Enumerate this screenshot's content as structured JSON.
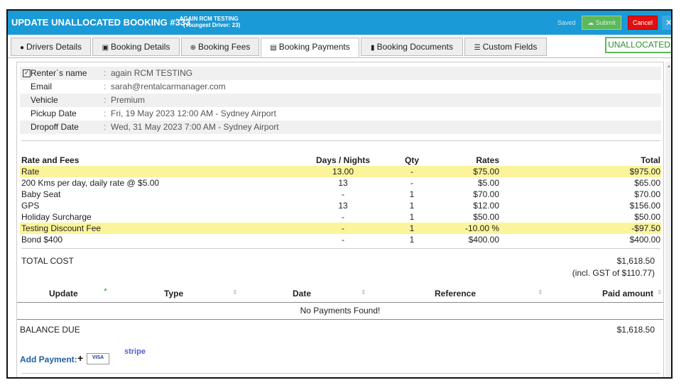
{
  "header": {
    "title": "UPDATE UNALLOCATED BOOKING #333",
    "subtitle_line1": "- AGAIN RCM TESTING",
    "subtitle_line2": "(Youngest Driver: 23)",
    "saved": "Saved",
    "submit_label": "Submit",
    "cancel_label": "Cancel",
    "close_label": "✕",
    "accent_color": "#1a9ad6"
  },
  "tabs": [
    {
      "label": "Drivers Details",
      "icon": "user-icon"
    },
    {
      "label": "Booking Details",
      "icon": "car-icon"
    },
    {
      "label": "Booking Fees",
      "icon": "plus-circle-icon"
    },
    {
      "label": "Booking Payments",
      "icon": "credit-card-icon",
      "active": true
    },
    {
      "label": "Booking Documents",
      "icon": "document-icon"
    },
    {
      "label": "Custom Fields",
      "icon": "list-icon"
    }
  ],
  "status_badge": "UNALLOCATED",
  "info": {
    "renter_label": "Renter`s name",
    "renter_value": "again RCM TESTING",
    "email_label": "Email",
    "email_value": "sarah@rentalcarmanager.com",
    "vehicle_label": "Vehicle",
    "vehicle_value": "Premium",
    "pickup_label": "Pickup Date",
    "pickup_value": "Fri, 19 May 2023 12:00 AM - Sydney Airport",
    "dropoff_label": "Dropoff Date",
    "dropoff_value": "Wed, 31 May 2023 7:00 AM - Sydney Airport",
    "separator": ":"
  },
  "fees": {
    "headers": {
      "name": "Rate and Fees",
      "days": "Days / Nights",
      "qty": "Qty",
      "rates": "Rates",
      "total": "Total"
    },
    "rows": [
      {
        "name": "Rate",
        "days": "13.00",
        "qty": "-",
        "rate": "$75.00",
        "total": "$975.00",
        "highlight": true
      },
      {
        "name": "200 Kms per day, daily rate @ $5.00",
        "days": "13",
        "qty": "-",
        "rate": "$5.00",
        "total": "$65.00",
        "highlight": false
      },
      {
        "name": "Baby Seat",
        "days": "-",
        "qty": "1",
        "rate": "$70.00",
        "total": "$70.00",
        "highlight": false
      },
      {
        "name": "GPS",
        "days": "13",
        "qty": "1",
        "rate": "$12.00",
        "total": "$156.00",
        "highlight": false
      },
      {
        "name": "Holiday Surcharge",
        "days": "-",
        "qty": "1",
        "rate": "$50.00",
        "total": "$50.00",
        "highlight": false
      },
      {
        "name": "Testing Discount Fee",
        "days": "-",
        "qty": "1",
        "rate": "-10.00 %",
        "total": "-$97.50",
        "highlight": true
      },
      {
        "name": "Bond $400",
        "days": "-",
        "qty": "1",
        "rate": "$400.00",
        "total": "$400.00",
        "highlight": false
      }
    ]
  },
  "totals": {
    "total_label": "TOTAL COST",
    "total_value": "$1,618.50",
    "gst": "(incl. GST of $110.77)"
  },
  "payments": {
    "headers": {
      "update": "Update",
      "type": "Type",
      "date": "Date",
      "reference": "Reference",
      "paid": "Paid amount"
    },
    "empty_text": "No Payments Found!"
  },
  "balance": {
    "label": "BALANCE DUE",
    "value": "$1,618.50"
  },
  "add_payment": {
    "label": "Add Payment:",
    "visa_text": "VISA",
    "stripe_text": "stripe"
  }
}
